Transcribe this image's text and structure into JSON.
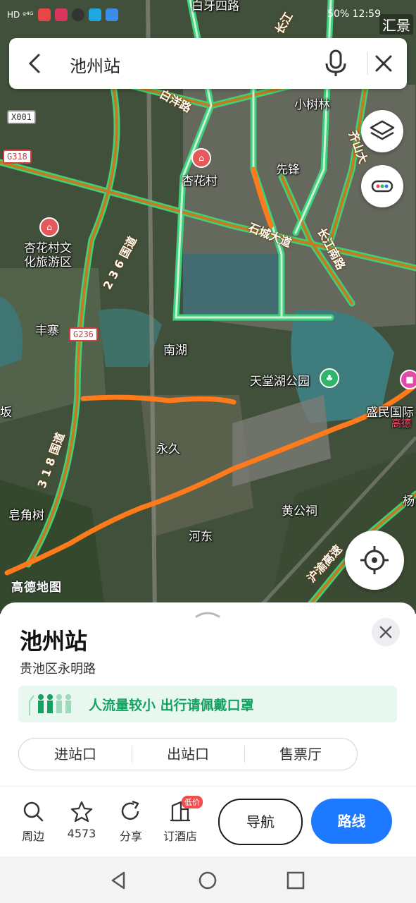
{
  "status_bar": {
    "left": "HD ᵍ⁴ᴳ",
    "right": "50%  12:59",
    "corner_label": "汇景"
  },
  "search": {
    "query": "池州站"
  },
  "map": {
    "places": [
      {
        "name": "白牙四路"
      },
      {
        "name": "小树林"
      },
      {
        "name": "杏花村"
      },
      {
        "name": "先锋"
      },
      {
        "name": "杏花村文化旅游区"
      },
      {
        "name": "丰寨"
      },
      {
        "name": "南湖"
      },
      {
        "name": "天堂湖公园"
      },
      {
        "name": "盛民国际"
      },
      {
        "name": "永久"
      },
      {
        "name": "黄公祠"
      },
      {
        "name": "皂角树"
      },
      {
        "name": "河东"
      },
      {
        "name": "坂"
      },
      {
        "name": "杨"
      },
      {
        "name": "高德"
      }
    ],
    "roads": [
      {
        "name": "白洋路"
      },
      {
        "name": "石城大道"
      },
      {
        "name": "长江南路"
      },
      {
        "name": "2 3 6 国道"
      },
      {
        "name": "3 1 8 国道"
      },
      {
        "name": "齐山大"
      },
      {
        "name": "长江"
      },
      {
        "name": "沪渝高速"
      }
    ],
    "shields": [
      "X001",
      "G318",
      "G236"
    ],
    "logo": "高德地图",
    "colors": {
      "road_green": "#3fd17a",
      "road_orange": "#c47a1e",
      "trace_orange": "#ff7a1a"
    }
  },
  "controls": {
    "layers_icon": "layers-icon",
    "route_icon": "more-dots-icon",
    "locate_icon": "locate-icon"
  },
  "sheet": {
    "title": "池州站",
    "address": "贵池区永明路",
    "notice": "人流量较小  出行请佩戴口罩",
    "segments": [
      "进站口",
      "出站口",
      "售票厅"
    ]
  },
  "actions": {
    "nearby": "周边",
    "favorites": "4573",
    "share": "分享",
    "hotel": "订酒店",
    "hotel_badge": "低价",
    "navigate": "导航",
    "route": "路线",
    "accent": "#1d79ff"
  }
}
